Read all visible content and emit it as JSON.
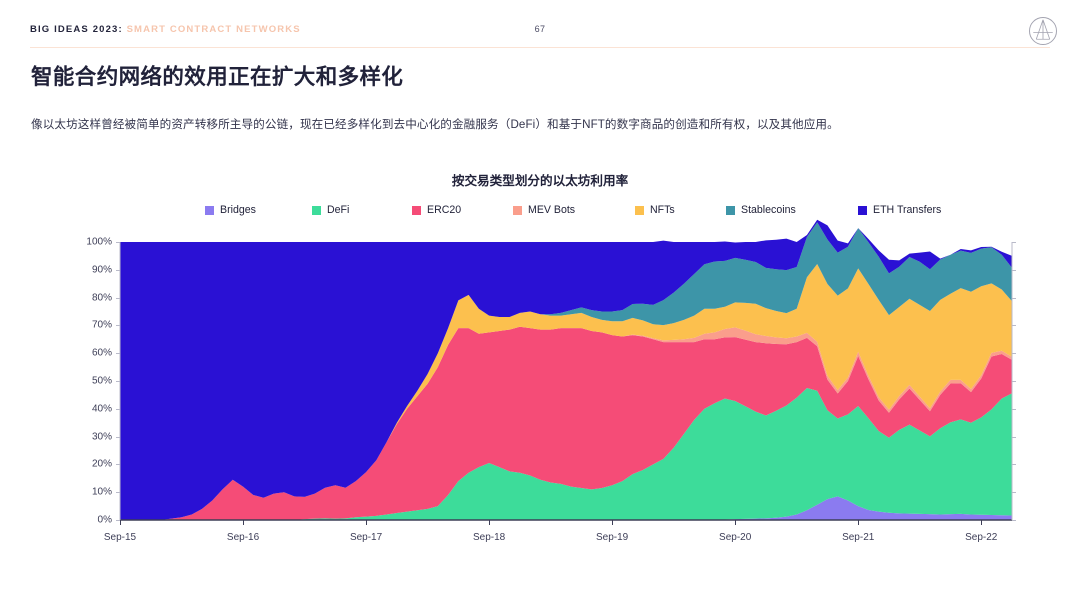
{
  "header": {
    "brand": "BIG IDEAS 2023",
    "separator": ":",
    "section": "SMART CONTRACT NETWORKS",
    "page_number": "67",
    "logo_name": "ark-invest-logo",
    "rule_color": "#fbe3d5",
    "brand_color": "#23243b",
    "section_color": "#f6c5ad"
  },
  "title": "智能合约网络的效用正在扩大和多样化",
  "subtitle": "像以太坊这样曾经被简单的资产转移所主导的公链，现在已经多样化到去中心化的金融服务（DeFi）和基于NFT的数字商品的创造和所有权，以及其他应用。",
  "chart_data": {
    "type": "area",
    "stacked": true,
    "title": "按交易类型划分的以太坊利用率",
    "xlabel": "",
    "ylabel": "",
    "ylim": [
      0,
      100
    ],
    "ytick_labels": [
      "100%",
      "90%",
      "80%",
      "70%",
      "60%",
      "50%",
      "40%",
      "30%",
      "20%",
      "10%",
      "0%"
    ],
    "ytick_values": [
      100,
      90,
      80,
      70,
      60,
      50,
      40,
      30,
      20,
      10,
      0
    ],
    "xtick_labels": [
      "Sep-15",
      "Sep-16",
      "Sep-17",
      "Sep-18",
      "Sep-19",
      "Sep-20",
      "Sep-21",
      "Sep-22"
    ],
    "xtick_positions": [
      0,
      12,
      24,
      36,
      48,
      60,
      72,
      84
    ],
    "x_count": 88,
    "grid": false,
    "legend_position": "top",
    "series": [
      {
        "name": "Bridges",
        "color": "#8b7bf0",
        "values": [
          0,
          0,
          0,
          0,
          0,
          0,
          0,
          0,
          0,
          0,
          0,
          0,
          0,
          0,
          0,
          0,
          0,
          0,
          0,
          0,
          0,
          0,
          0,
          0,
          0,
          0,
          0,
          0,
          0,
          0,
          0,
          0,
          0,
          0,
          0,
          0,
          0,
          0,
          0,
          0,
          0,
          0,
          0,
          0,
          0,
          0,
          0,
          0,
          0,
          0,
          0,
          0,
          0,
          0,
          0,
          0,
          0,
          0,
          0,
          0.2,
          0.3,
          0.4,
          0.5,
          0.6,
          0.8,
          1.2,
          2.0,
          3.5,
          5.5,
          7.5,
          8.5,
          7.0,
          5.0,
          3.6,
          3.0,
          2.6,
          2.4,
          2.3,
          2.2,
          2.1,
          2.0,
          2.1,
          2.2,
          2.0,
          1.9,
          1.8,
          1.7,
          1.6
        ]
      },
      {
        "name": "DeFi",
        "color": "#3ddc9a",
        "values": [
          0,
          0,
          0,
          0,
          0,
          0,
          0,
          0,
          0,
          0,
          0,
          0,
          0,
          0,
          0,
          0,
          0,
          0,
          0.3,
          0.5,
          0.6,
          0.5,
          0.6,
          1.0,
          1.2,
          1.5,
          2.0,
          2.5,
          3.0,
          3.5,
          4.0,
          5.0,
          9.0,
          14.0,
          17.0,
          19.0,
          20.5,
          19.0,
          17.5,
          17.0,
          16.0,
          14.5,
          13.5,
          13.0,
          12.0,
          11.5,
          11.0,
          11.5,
          12.5,
          14.0,
          16.5,
          18.0,
          20.0,
          22.0,
          26.0,
          31.0,
          36.0,
          40.0,
          42.0,
          43.5,
          42.5,
          40.5,
          38.5,
          37.0,
          38.5,
          40.0,
          42.0,
          44.0,
          41.0,
          32.0,
          28.0,
          31.0,
          36.0,
          33.0,
          29.0,
          27.0,
          30.0,
          32.0,
          30.0,
          28.0,
          31.0,
          33.0,
          34.0,
          33.0,
          35.0,
          38.0,
          42.0,
          44.0
        ]
      },
      {
        "name": "ERC20",
        "color": "#f54c77",
        "values": [
          0,
          0,
          0,
          0,
          0,
          0.5,
          1.0,
          2.0,
          4.0,
          7.0,
          11.0,
          14.5,
          12.0,
          9.0,
          8.0,
          9.5,
          10.0,
          8.5,
          8.0,
          9.0,
          11.0,
          12.0,
          11.0,
          13.0,
          16.0,
          20.0,
          26.0,
          32.0,
          37.0,
          41.0,
          45.0,
          50.0,
          54.0,
          55.0,
          52.0,
          48.0,
          47.0,
          49.0,
          51.0,
          52.5,
          53.0,
          54.0,
          55.0,
          56.0,
          57.0,
          57.5,
          57.0,
          56.0,
          54.0,
          52.0,
          50.0,
          48.0,
          45.0,
          42.0,
          38.0,
          33.0,
          28.0,
          25.0,
          23.0,
          22.0,
          23.0,
          24.0,
          25.0,
          26.0,
          24.0,
          22.0,
          20.0,
          18.0,
          16.0,
          11.0,
          9.0,
          12.0,
          18.0,
          14.0,
          11.0,
          9.0,
          11.0,
          13.0,
          11.0,
          9.0,
          12.0,
          14.0,
          13.0,
          11.0,
          14.0,
          19.0,
          16.0,
          12.0
        ]
      },
      {
        "name": "MEV Bots",
        "color": "#fa9e8c",
        "values": [
          0,
          0,
          0,
          0,
          0,
          0,
          0,
          0,
          0,
          0,
          0,
          0,
          0,
          0,
          0,
          0,
          0,
          0,
          0,
          0,
          0,
          0,
          0,
          0,
          0,
          0,
          0,
          0,
          0,
          0,
          0,
          0,
          0,
          0,
          0,
          0,
          0,
          0,
          0,
          0,
          0,
          0,
          0,
          0,
          0,
          0,
          0,
          0,
          0,
          0,
          0.2,
          0.3,
          0.4,
          0.6,
          0.8,
          1.0,
          1.5,
          2.0,
          2.5,
          3.0,
          3.5,
          3.2,
          2.8,
          2.6,
          2.4,
          2.2,
          2.0,
          1.8,
          1.6,
          1.4,
          1.2,
          1.3,
          1.5,
          1.3,
          1.2,
          1.1,
          1.2,
          1.3,
          1.2,
          1.1,
          1.2,
          1.3,
          1.2,
          1.1,
          1.2,
          1.3,
          1.2,
          1.1
        ]
      },
      {
        "name": "NFTs",
        "color": "#fcc04e",
        "values": [
          0,
          0,
          0,
          0,
          0,
          0,
          0,
          0,
          0,
          0,
          0,
          0,
          0,
          0,
          0,
          0,
          0,
          0,
          0,
          0,
          0,
          0,
          0,
          0,
          0,
          0,
          0,
          0.5,
          1.0,
          2.0,
          3.5,
          5.0,
          6.0,
          10.0,
          12.0,
          9.0,
          6.0,
          5.0,
          4.5,
          5.0,
          6.0,
          5.5,
          5.0,
          4.5,
          5.0,
          5.5,
          5.0,
          4.5,
          5.0,
          5.5,
          6.0,
          5.5,
          5.0,
          5.5,
          6.0,
          7.0,
          8.0,
          9.0,
          8.5,
          8.0,
          9.0,
          10.0,
          11.0,
          10.0,
          9.5,
          9.0,
          10.0,
          20.0,
          28.0,
          33.0,
          34.0,
          32.0,
          30.0,
          33.0,
          35.0,
          34.0,
          32.0,
          31.0,
          33.0,
          35.0,
          33.0,
          31.0,
          33.0,
          35.0,
          32.0,
          25.0,
          22.0,
          20.0
        ]
      },
      {
        "name": "Stablecoins",
        "color": "#3d95a8",
        "values": [
          0,
          0,
          0,
          0,
          0,
          0,
          0,
          0,
          0,
          0,
          0,
          0,
          0,
          0,
          0,
          0,
          0,
          0,
          0,
          0,
          0,
          0,
          0,
          0,
          0,
          0,
          0,
          0,
          0,
          0,
          0,
          0,
          0,
          0,
          0,
          0,
          0,
          0,
          0,
          0,
          0,
          0,
          0.5,
          1.0,
          1.5,
          2.0,
          2.5,
          3.0,
          3.5,
          4.0,
          5.0,
          6.0,
          7.0,
          9.0,
          11.0,
          13.0,
          15.0,
          16.0,
          17.0,
          16.5,
          16.0,
          15.5,
          15.0,
          14.5,
          15.0,
          15.5,
          15.0,
          14.5,
          15.0,
          16.0,
          15.5,
          15.0,
          14.5,
          15.0,
          15.5,
          15.0,
          14.5,
          15.0,
          15.5,
          15.0,
          14.5,
          14.0,
          13.5,
          14.0,
          13.5,
          13.0,
          12.5,
          12.0
        ]
      },
      {
        "name": "ETH Transfers",
        "color": "#2a11d4",
        "values": [
          100,
          100,
          100,
          100,
          100,
          99.5,
          99,
          98,
          96,
          93,
          89,
          85.5,
          88,
          91,
          92,
          90.5,
          90,
          91.5,
          91.7,
          90.5,
          88.4,
          87.5,
          88.4,
          86,
          82.8,
          78.5,
          72,
          65,
          59,
          53.5,
          47.5,
          40,
          31,
          21,
          19,
          24,
          26.5,
          27,
          27,
          25.5,
          25,
          26,
          26,
          25.5,
          24.5,
          23.5,
          24.5,
          25,
          25,
          24.5,
          22.3,
          22.2,
          22.6,
          21.4,
          18.2,
          15,
          11.5,
          8,
          7,
          7,
          5.5,
          6.4,
          7.2,
          9.9,
          10.6,
          11.3,
          9.0,
          0.7,
          0.9,
          5.1,
          4.3,
          1.2,
          0,
          1.2,
          2.3,
          4.9,
          2.3,
          1.2,
          3.3,
          6.4,
          0.3,
          0,
          0.6,
          0.9,
          0.6,
          0.2,
          1.1,
          4.3
        ]
      }
    ]
  },
  "axis": {
    "tick_color": "#3d3e57",
    "label_color": "#3d3e57"
  }
}
